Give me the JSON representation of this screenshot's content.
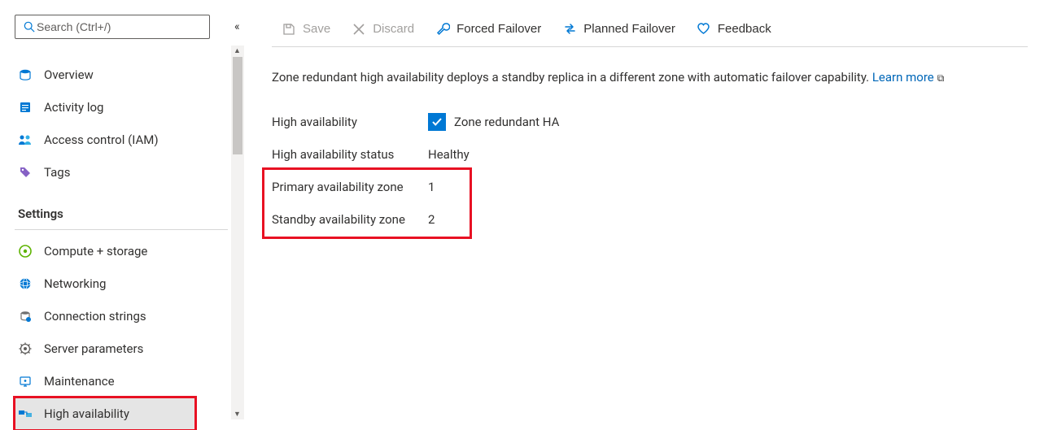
{
  "search": {
    "placeholder": "Search (Ctrl+/)"
  },
  "sidebar": {
    "items": {
      "overview": {
        "label": "Overview"
      },
      "activity": {
        "label": "Activity log"
      },
      "iam": {
        "label": "Access control (IAM)"
      },
      "tags": {
        "label": "Tags"
      }
    },
    "settings_header": "Settings",
    "settings": {
      "compute": {
        "label": "Compute + storage"
      },
      "network": {
        "label": "Networking"
      },
      "conn": {
        "label": "Connection strings"
      },
      "params": {
        "label": "Server parameters"
      },
      "maint": {
        "label": "Maintenance"
      },
      "ha": {
        "label": "High availability"
      }
    }
  },
  "toolbar": {
    "save": "Save",
    "discard": "Discard",
    "forced": "Forced Failover",
    "planned": "Planned Failover",
    "feedback": "Feedback"
  },
  "description": {
    "text": "Zone redundant high availability deploys a standby replica in a different zone with automatic failover capability. ",
    "link": "Learn more"
  },
  "ha": {
    "label_ha": "High availability",
    "checkbox_label": "Zone redundant HA",
    "label_status": "High availability status",
    "status_value": "Healthy",
    "label_primary": "Primary availability zone",
    "primary_value": "1",
    "label_standby": "Standby availability zone",
    "standby_value": "2"
  }
}
